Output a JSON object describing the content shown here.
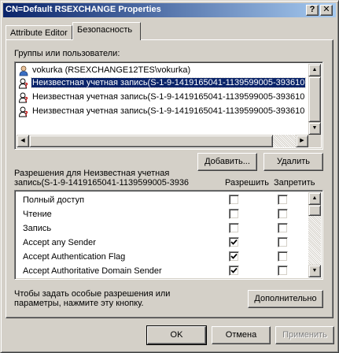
{
  "window": {
    "title": "CN=Default RSEXCHANGE Properties",
    "help_glyph": "?",
    "close_glyph": "✕"
  },
  "tabs": [
    {
      "label": "Attribute Editor",
      "active": false
    },
    {
      "label": "Безопасность",
      "active": true
    }
  ],
  "groups": {
    "label": "Группы или пользователи:",
    "items": [
      {
        "name": "vokurka (RSEXCHANGE12TES\\vokurka)",
        "icon": "user-icon",
        "selected": false
      },
      {
        "name": "Неизвестная учетная запись(S-1-9-1419165041-1139599005-393610",
        "icon": "unknown-account-icon",
        "selected": true
      },
      {
        "name": "Неизвестная учетная запись(S-1-9-1419165041-1139599005-393610",
        "icon": "unknown-account-icon",
        "selected": false
      },
      {
        "name": "Неизвестная учетная запись(S-1-9-1419165041-1139599005-393610",
        "icon": "unknown-account-icon",
        "selected": false
      }
    ],
    "add_button": "Добавить...",
    "remove_button": "Удалить"
  },
  "permissions": {
    "label_line1": "Разрешения для Неизвестная учетная",
    "label_line2": "запись(S-1-9-1419165041-1139599005-3936",
    "allow_header": "Разрешить",
    "deny_header": "Запретить",
    "items": [
      {
        "name": "Полный доступ",
        "allow": false,
        "deny": false
      },
      {
        "name": "Чтение",
        "allow": false,
        "deny": false
      },
      {
        "name": "Запись",
        "allow": false,
        "deny": false
      },
      {
        "name": "Accept any Sender",
        "allow": true,
        "deny": false
      },
      {
        "name": "Accept Authentication Flag",
        "allow": true,
        "deny": false
      },
      {
        "name": "Accept Authoritative Domain Sender",
        "allow": true,
        "deny": false
      }
    ]
  },
  "advanced": {
    "hint_line1": "Чтобы задать особые разрешения или",
    "hint_line2": "параметры, нажмите эту кнопку.",
    "button": "Дополнительно"
  },
  "footer": {
    "ok": "OK",
    "cancel": "Отмена",
    "apply": "Применить"
  },
  "colors": {
    "selection": "#0a246a",
    "face": "#d4d0c8"
  }
}
